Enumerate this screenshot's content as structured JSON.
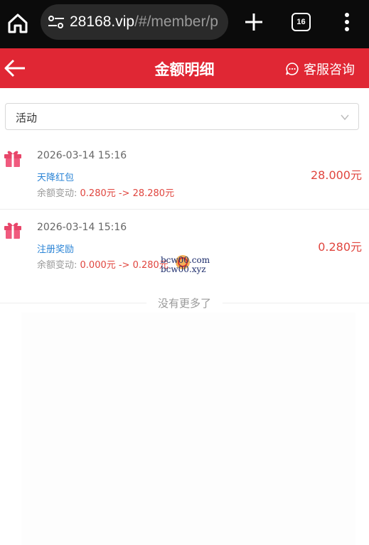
{
  "browser": {
    "url_host": "28168.vip",
    "url_path": "/#/member/p",
    "tab_count": "16",
    "icons": [
      "home-icon",
      "tune-icon",
      "plus-icon",
      "tabs-icon",
      "more-vert-icon"
    ]
  },
  "header": {
    "title": "金额明细",
    "service_label": "客服咨询",
    "color": "#e02734"
  },
  "filter": {
    "selected": "活动"
  },
  "records": [
    {
      "datetime": "2026-03-14 15:16",
      "type": "天降红包",
      "change_label": "余额变动: ",
      "balance_before": "0.280元",
      "arrow": " -> ",
      "balance_after": "28.280元",
      "amount": "28.000元"
    },
    {
      "datetime": "2026-03-14 15:16",
      "type": "注册奖励",
      "change_label": "余额变动: ",
      "balance_before": "0.000元",
      "arrow": " -> ",
      "balance_after": "0.280元",
      "amount": "0.280元"
    }
  ],
  "watermark": {
    "line1": "bcw00.com",
    "line2": "bcw00.xyz"
  },
  "footer": {
    "end_text": "没有更多了"
  }
}
